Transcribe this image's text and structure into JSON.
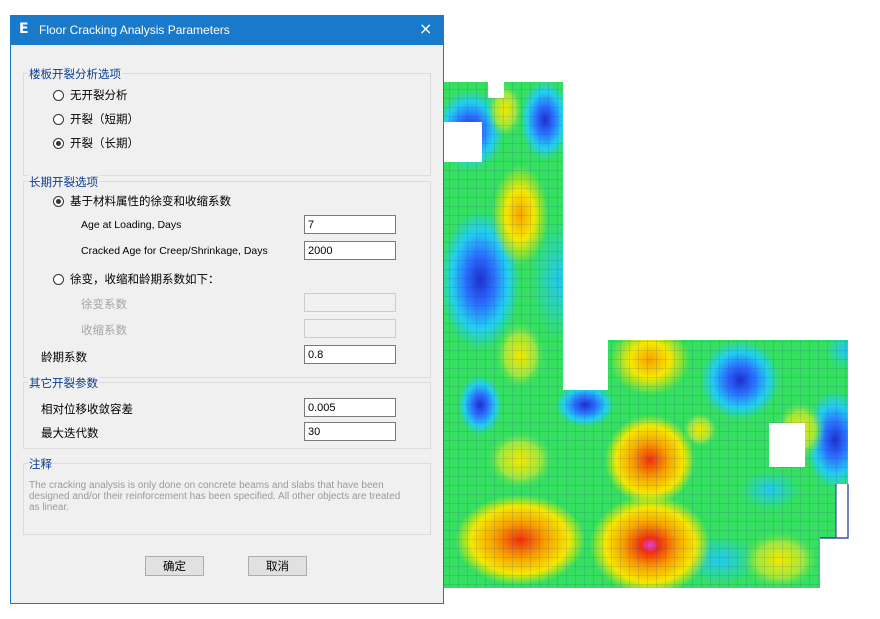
{
  "dialog": {
    "app_icon": "E",
    "title": "Floor Cracking Analysis Parameters",
    "close_glyph": "×",
    "group1": {
      "legend": "楼板开裂分析选项",
      "options": [
        "无开裂分析",
        "开裂（短期）",
        "开裂（长期）"
      ],
      "selected": 2
    },
    "group2": {
      "legend": "长期开裂选项",
      "option_material": "基于材料属性的徐变和收缩系数",
      "age_loading_label": "Age at Loading,  Days",
      "age_loading_value": "7",
      "cracked_age_label": "Cracked Age for Creep/Shrinkage,  Days",
      "cracked_age_value": "2000",
      "option_custom": "徐变，收缩和龄期系数如下：",
      "creep_label": "徐变系数",
      "creep_value": "",
      "shrink_label": "收缩系数",
      "shrink_value": "",
      "aging_label": "龄期系数",
      "aging_value": "0.8",
      "selected": 0
    },
    "group3": {
      "legend": "其它开裂参数",
      "tolerance_label": "相对位移收敛容差",
      "tolerance_value": "0.005",
      "max_iter_label": "最大迭代数",
      "max_iter_value": "30"
    },
    "group4": {
      "legend": "注释",
      "text": "The cracking analysis is only done on concrete beams and slabs that have been designed and/or their reinforcement has been specified. All other objects are treated as linear."
    },
    "ok_label": "确定",
    "cancel_label": "取消"
  },
  "contour_colors": {
    "blue": "#2b4fff",
    "cyan": "#22d0f0",
    "green": "#35e060",
    "yellow": "#f5e800",
    "orange": "#f7a200",
    "red": "#f03010",
    "magenta": "#e040e8"
  }
}
